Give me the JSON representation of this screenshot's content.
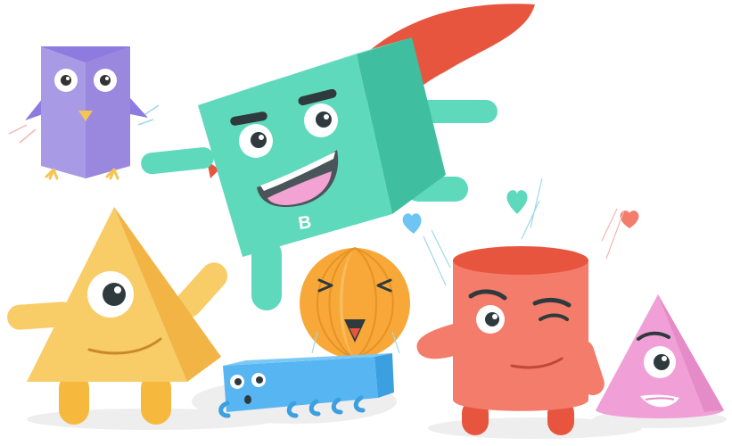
{
  "illustration": {
    "cube_badge_letter": "B",
    "characters": [
      {
        "id": "owl",
        "shape": "triangular-prism",
        "color": "#A99AE6"
      },
      {
        "id": "cube",
        "shape": "cube",
        "color": "#5FD9BC"
      },
      {
        "id": "pyramid",
        "shape": "pyramid",
        "color": "#F8CC67"
      },
      {
        "id": "sphere",
        "shape": "sphere",
        "color": "#F7A838"
      },
      {
        "id": "cuboid",
        "shape": "rectangular-prism",
        "color": "#57B6F2"
      },
      {
        "id": "cylinder",
        "shape": "cylinder",
        "color": "#F47C6A"
      },
      {
        "id": "cone",
        "shape": "cone",
        "color": "#F0A0D6"
      }
    ],
    "cape_color": "#E8553F",
    "heart_colors": [
      "#5FD9BC",
      "#6EC5F2",
      "#F47C6A"
    ]
  }
}
